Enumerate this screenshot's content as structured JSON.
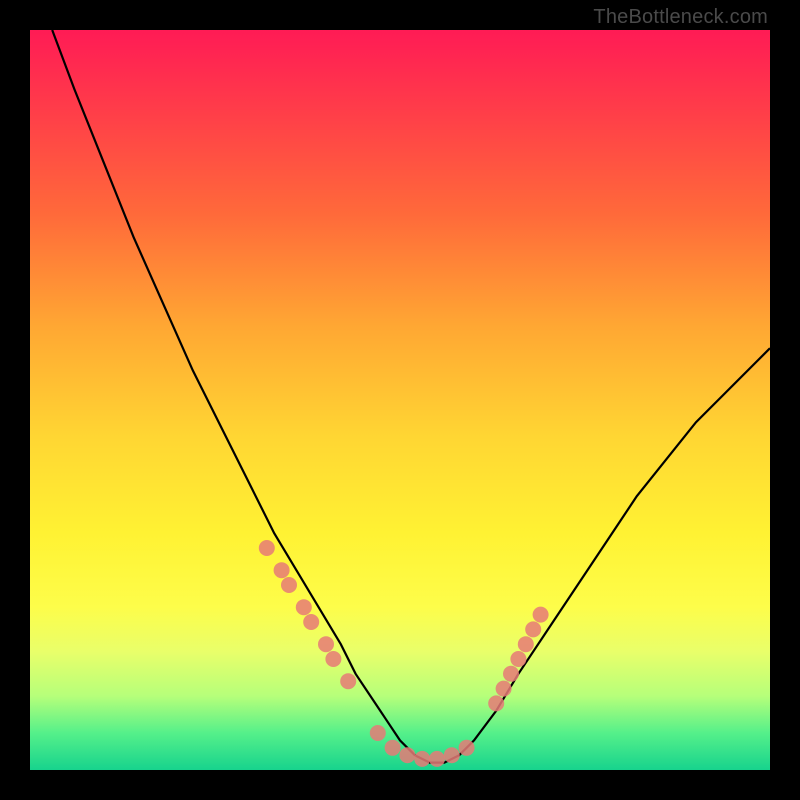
{
  "watermark": "TheBottleneck.com",
  "chart_data": {
    "type": "line",
    "title": "",
    "xlabel": "",
    "ylabel": "",
    "xlim": [
      0,
      100
    ],
    "ylim": [
      0,
      100
    ],
    "series": [
      {
        "name": "bottleneck-curve",
        "x": [
          3,
          6,
          10,
          14,
          18,
          22,
          26,
          30,
          33,
          36,
          39,
          42,
          44,
          46,
          48,
          50,
          52,
          54,
          56,
          58,
          60,
          63,
          66,
          70,
          74,
          78,
          82,
          86,
          90,
          94,
          98,
          100
        ],
        "y": [
          100,
          92,
          82,
          72,
          63,
          54,
          46,
          38,
          32,
          27,
          22,
          17,
          13,
          10,
          7,
          4,
          2,
          1,
          1,
          2,
          4,
          8,
          13,
          19,
          25,
          31,
          37,
          42,
          47,
          51,
          55,
          57
        ]
      }
    ],
    "markers": {
      "left_cluster": {
        "x": [
          32,
          34,
          35,
          37,
          38,
          40,
          41,
          43
        ],
        "y": [
          30,
          27,
          25,
          22,
          20,
          17,
          15,
          12
        ]
      },
      "bottom_cluster": {
        "x": [
          47,
          49,
          51,
          53,
          55,
          57,
          59
        ],
        "y": [
          5,
          3,
          2,
          1.5,
          1.5,
          2,
          3
        ]
      },
      "right_cluster": {
        "x": [
          63,
          64,
          65,
          66,
          67,
          68,
          69
        ],
        "y": [
          9,
          11,
          13,
          15,
          17,
          19,
          21
        ]
      }
    },
    "legend": [],
    "grid": false
  }
}
